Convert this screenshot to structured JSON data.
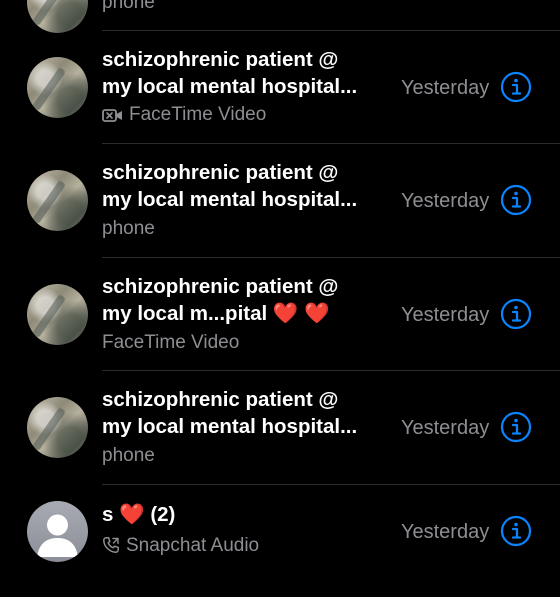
{
  "calls": [
    {
      "name_line1": "",
      "name_line2": "",
      "type": "phone",
      "time": "",
      "avatar": "photo"
    },
    {
      "name_line1": "schizophrenic patient @",
      "name_line2": "my local mental hospital...",
      "type": "FaceTime Video",
      "type_icon": "video-camera-icon",
      "time": "Yesterday",
      "avatar": "photo"
    },
    {
      "name_line1": "schizophrenic patient @",
      "name_line2": "my local mental hospital...",
      "type": "phone",
      "time": "Yesterday",
      "avatar": "photo"
    },
    {
      "name_line1": "schizophrenic patient @",
      "name_line2": "my local m...pital ❤️ ❤️",
      "type": "FaceTime Video",
      "time": "Yesterday",
      "avatar": "photo"
    },
    {
      "name_line1": "schizophrenic patient @",
      "name_line2": "my local mental hospital...",
      "type": "phone",
      "time": "Yesterday",
      "avatar": "photo"
    },
    {
      "name_line1": "s ❤️ (2)",
      "type": "Snapchat Audio",
      "type_icon": "phone-handset-icon",
      "time": "Yesterday",
      "avatar": "generic"
    }
  ],
  "colors": {
    "background": "#000000",
    "primary_text": "#ffffff",
    "secondary_text": "#8e8e93",
    "accent": "#0a84ff",
    "divider": "#2c2c2e",
    "heart": "#ff2a2a"
  }
}
